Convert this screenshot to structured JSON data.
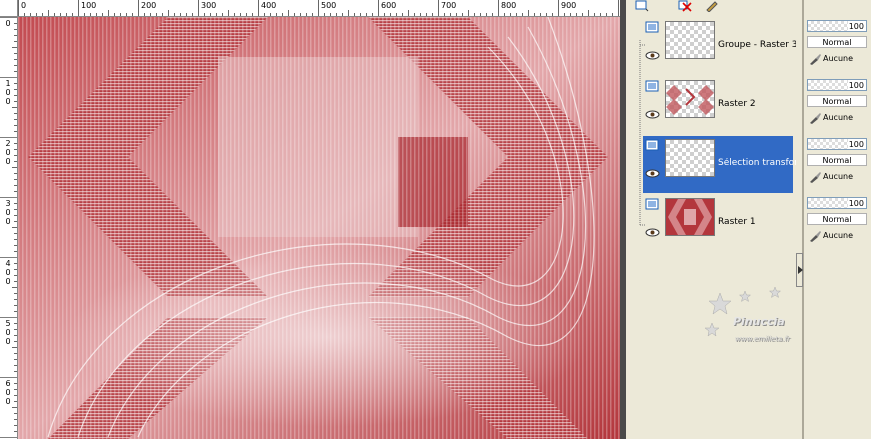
{
  "ruler": {
    "h_labels": [
      "0",
      "100",
      "200",
      "300",
      "400",
      "500",
      "600",
      "700",
      "800",
      "900"
    ],
    "v_labels": [
      "0",
      "1\n0\n0",
      "2\n0\n0",
      "3\n0\n0",
      "4\n0\n0",
      "5\n0\n0",
      "6\n0\n0"
    ]
  },
  "canvas": {
    "base_color": "#b3363c",
    "highlight_color": "#ffffff"
  },
  "toolbar": {
    "icons": [
      "new-layer-icon",
      "delete-layer-icon",
      "edit-icon"
    ]
  },
  "layers": [
    {
      "name": "Groupe - Raster 3",
      "opacity": "100",
      "blend": "Normal",
      "mask": "Aucune",
      "selected": false,
      "thumb": "transparent"
    },
    {
      "name": "Raster 2",
      "opacity": "100",
      "blend": "Normal",
      "mask": "Aucune",
      "selected": false,
      "thumb": "pattern"
    },
    {
      "name": "Sélection transformée",
      "opacity": "100",
      "blend": "Normal",
      "mask": "Aucune",
      "selected": true,
      "thumb": "transparent"
    },
    {
      "name": "Raster 1",
      "opacity": "100",
      "blend": "Normal",
      "mask": "Aucune",
      "selected": false,
      "thumb": "red"
    }
  ],
  "watermark": {
    "text1": "Pinuccia",
    "text2": "www.emilieta.fr"
  },
  "colors": {
    "selected": "#316ac5",
    "panel": "#ece9d8"
  }
}
